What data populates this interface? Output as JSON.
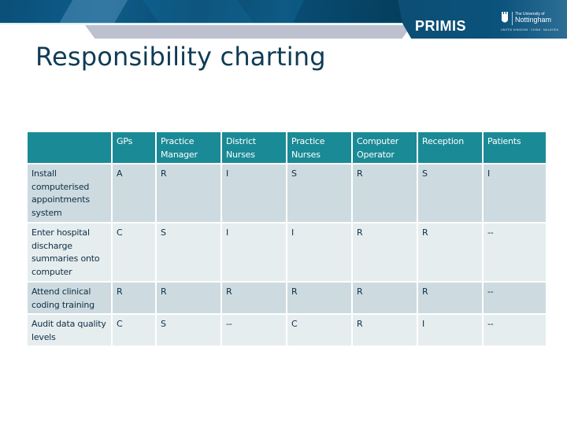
{
  "header": {
    "brand": "PRIMIS",
    "university": {
      "prefix": "The University of",
      "name": "Nottingham",
      "campuses": "UNITED KINGDOM · CHINA · MALAYSIA"
    }
  },
  "slide": {
    "title": "Responsibility charting"
  },
  "table": {
    "columns": [
      "",
      "GPs",
      "Practice Manager",
      "District Nurses",
      "Practice Nurses",
      "Computer Operator",
      "Reception",
      "Patients"
    ],
    "rows": [
      {
        "task": "Install computerised appointments system",
        "values": [
          "A",
          "R",
          "I",
          "S",
          "R",
          "S",
          "I"
        ]
      },
      {
        "task": "Enter hospital discharge summaries onto computer",
        "values": [
          "C",
          "S",
          "I",
          "I",
          "R",
          "R",
          "--"
        ]
      },
      {
        "task": "Attend clinical coding training",
        "values": [
          "R",
          "R",
          "R",
          "R",
          "R",
          "R",
          "--"
        ]
      },
      {
        "task": "Audit data quality levels",
        "values": [
          "C",
          "S",
          "--",
          "C",
          "R",
          "I",
          "--"
        ]
      }
    ]
  },
  "colors": {
    "banner": "#0b4f76",
    "header_row": "#1a8a96",
    "row_dark": "#cddbe0",
    "row_light": "#e6edef",
    "title_text": "#0f3b55"
  }
}
